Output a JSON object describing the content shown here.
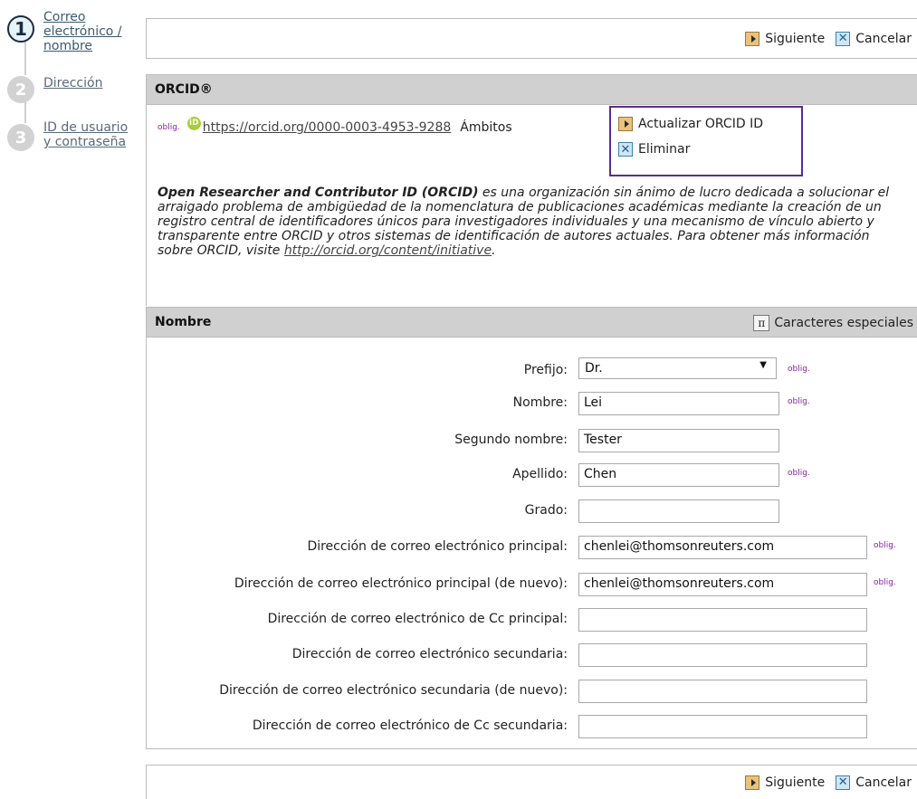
{
  "steps": [
    {
      "num": "1",
      "label": "Correo electrónico / nombre",
      "active": true
    },
    {
      "num": "2",
      "label": "Dirección",
      "active": false
    },
    {
      "num": "3",
      "label": "ID de usuario y contraseña",
      "active": false
    }
  ],
  "buttons": {
    "next": "Siguiente",
    "cancel": "Cancelar"
  },
  "orcid": {
    "header": "ORCID®",
    "required": "oblig.",
    "logo": "iD",
    "url": "https://orcid.org/0000-0003-4953-9288",
    "scopes_label": "Ámbitos",
    "update_button": "Actualizar ORCID ID",
    "delete_button": "Eliminar",
    "desc_strong": "Open Researcher and Contributor ID (ORCID)",
    "desc_text": " es una organización sin ánimo de lucro dedicada a solucionar el arraigado problema de ambigüedad de la nomenclatura de publicaciones académicas mediante la creación de un registro central de identificadores únicos para investigadores individuales y una mecanismo de vínculo abierto y transparente entre ORCID y otros sistemas de identificación de autores actuales. Para obtener más información sobre ORCID, visite ",
    "desc_link": "http://orcid.org/content/initiative",
    "desc_end": "."
  },
  "name_section": {
    "header": "Nombre",
    "special_chars": "Caracteres especiales",
    "required": "oblig.",
    "fields": {
      "prefix": {
        "label": "Prefijo:",
        "value": "Dr."
      },
      "first": {
        "label": "Nombre:",
        "value": "Lei"
      },
      "middle": {
        "label": "Segundo nombre:",
        "value": "Tester"
      },
      "last": {
        "label": "Apellido:",
        "value": "Chen"
      },
      "degree": {
        "label": "Grado:",
        "value": ""
      },
      "email": {
        "label": "Dirección de correo electrónico principal:",
        "value": "chenlei@thomsonreuters.com"
      },
      "email_confirm": {
        "label": "Dirección de correo electrónico principal (de nuevo):",
        "value": "chenlei@thomsonreuters.com"
      },
      "cc_primary": {
        "label": "Dirección de correo electrónico de Cc principal:",
        "value": ""
      },
      "email_secondary": {
        "label": "Dirección de correo electrónico secundaria:",
        "value": ""
      },
      "email_secondary_confirm": {
        "label": "Dirección de correo electrónico secundaria (de nuevo):",
        "value": ""
      },
      "cc_secondary": {
        "label": "Dirección de correo electrónico de Cc secundaria:",
        "value": ""
      }
    }
  },
  "colors": {
    "header_bg": "#d0d0d0",
    "required": "#8a1fa2",
    "orcid_green": "#a6ce39",
    "highlight_border": "#5c2c8d"
  }
}
